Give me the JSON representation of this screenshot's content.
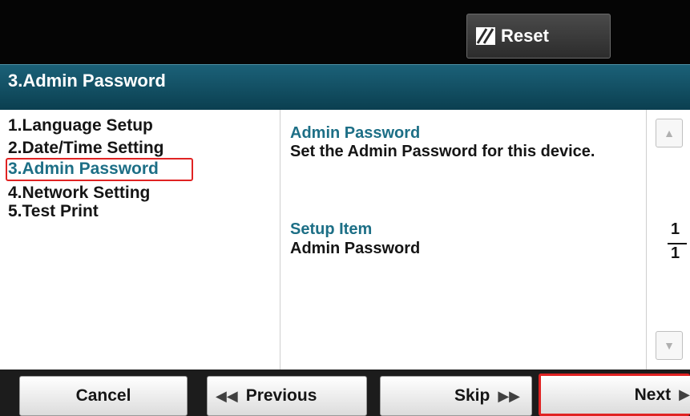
{
  "header": {
    "reset_label": "Reset",
    "reset_icon": "reset-icon"
  },
  "title": "3.Admin Password",
  "menu": {
    "items": [
      {
        "label": "1.Language Setup",
        "selected": false
      },
      {
        "label": "2.Date/Time Setting",
        "selected": false
      },
      {
        "label": "3.Admin Password",
        "selected": true
      },
      {
        "label": "4.Network Setting",
        "selected": false
      },
      {
        "label": "5.Test Print",
        "selected": false
      }
    ]
  },
  "detail": {
    "heading1": "Admin Password",
    "text1": "Set the Admin Password for this device.",
    "heading2": "Setup Item",
    "text2": "Admin Password"
  },
  "scroll": {
    "up_icon": "scroll-up-icon",
    "down_icon": "scroll-down-icon",
    "page_current": "1",
    "page_total": "1"
  },
  "footer": {
    "cancel_label": "Cancel",
    "previous_label": "Previous",
    "skip_label": "Skip",
    "next_label": "Next"
  },
  "colors": {
    "accent_teal": "#1d6f86",
    "highlight_red": "#e02323",
    "title_band": "#0b3f50",
    "top_bar": "#050505"
  }
}
